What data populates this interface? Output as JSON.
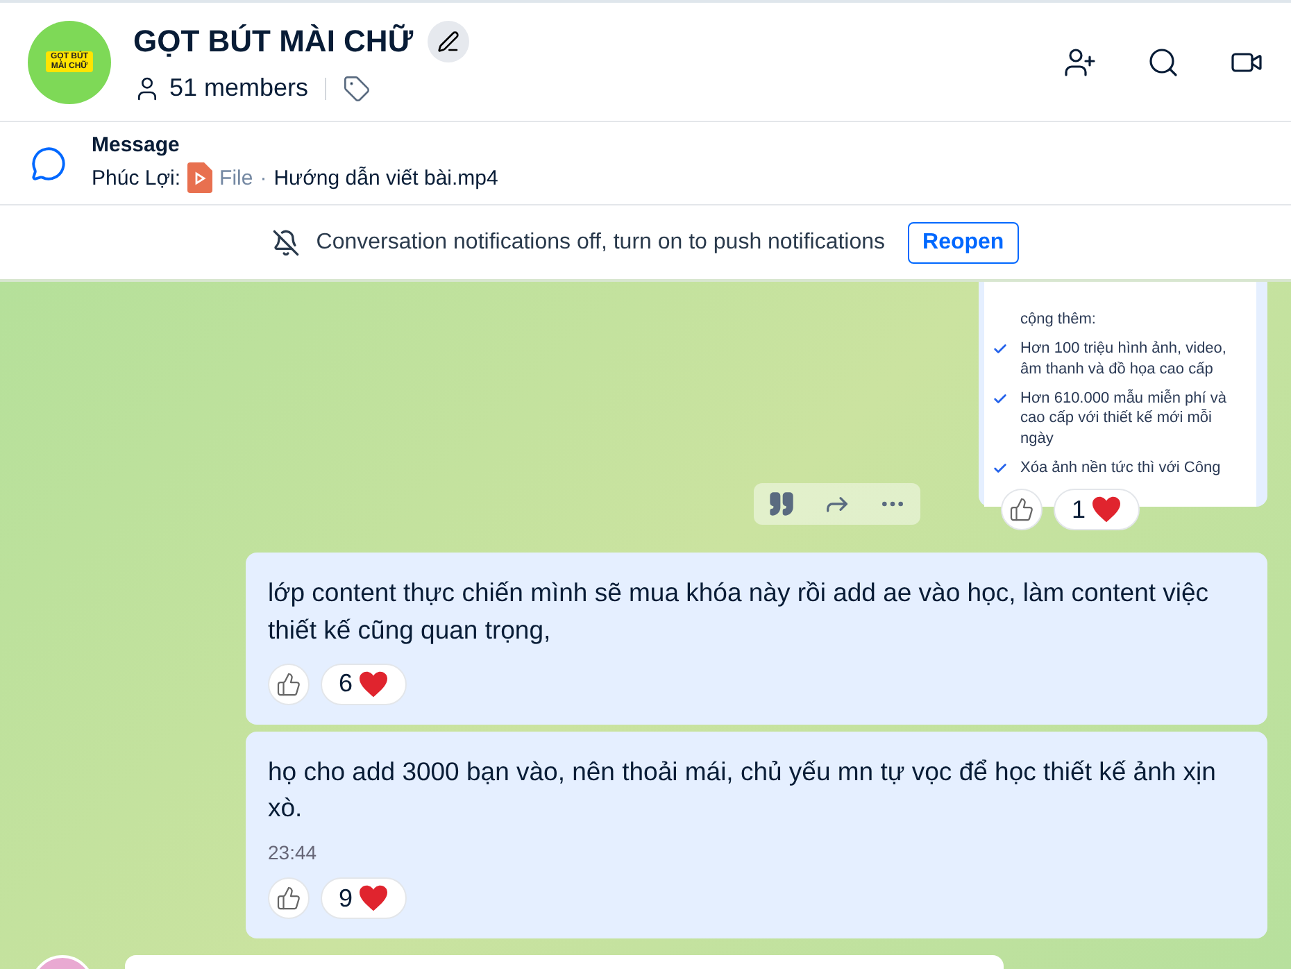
{
  "header": {
    "logo_text": "GỌT BÚT MÀI CHỮ",
    "title": "GỌT BÚT MÀI CHỮ",
    "members": "51 members"
  },
  "pinned": {
    "title": "Message",
    "sender": "Phúc Lợi:",
    "file_label": "File",
    "separator": "·",
    "file_name": "Hướng dẫn viết bài.mp4"
  },
  "notice": {
    "text": "Conversation notifications off, turn on to push notifications",
    "button": "Reopen"
  },
  "messages": [
    {
      "kind": "image",
      "image_lines": [
        {
          "check": false,
          "text": "cộng thêm:"
        },
        {
          "check": true,
          "text": "Hơn 100 triệu hình ảnh, video, âm thanh và đồ họa cao cấp"
        },
        {
          "check": true,
          "text": "Hơn 610.000 mẫu miễn phí và cao cấp với thiết kế mới mỗi ngày"
        },
        {
          "check": true,
          "text": "Xóa ảnh nền tức thì với Công"
        }
      ],
      "count": "1"
    },
    {
      "kind": "text",
      "text": "lớp content thực chiến mình sẽ mua khóa này rồi add ae vào học, làm content việc thiết kế cũng quan trọng,",
      "count": "6"
    },
    {
      "kind": "text",
      "text": "họ cho add 3000 bạn vào, nên thoải mái, chủ yếu mn tự vọc để học thiết kế ảnh xịn xò.",
      "time": "23:44",
      "count": "9"
    }
  ]
}
